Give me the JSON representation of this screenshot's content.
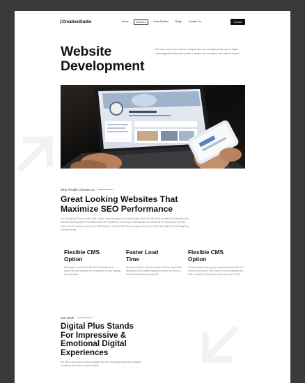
{
  "brand": {
    "name": "CreativeStudio"
  },
  "nav": {
    "links": [
      {
        "label": "Home",
        "active": false
      },
      {
        "label": "Services",
        "active": true
      },
      {
        "label": "Case Studies",
        "active": false
      },
      {
        "label": "Blogs",
        "active": false
      },
      {
        "label": "Contact Us",
        "active": false
      }
    ],
    "cta": "Contact"
  },
  "hero": {
    "title_line1": "Website",
    "title_line2": "Development",
    "description": "We help e-commerce brands navigate the ever-changing landscape of digital marketing with tactics that create a modern yet consistent web-based channel."
  },
  "why": {
    "eyebrow": "Why People Choose Us",
    "title_line1": "Great Looking Websites That",
    "title_line2": "Maximize SEO Performance",
    "description": "Our Designing Process starts with a basic understanding and crucial insight after that. We head towards the drawing board and start giving shape to our ideas which are backed by a thorough understanding of brands. At the completion of these steps, we are ready to move on to Wireframing. Once the Wireframe is approved by our client We begin the final designing of components."
  },
  "features": [
    {
      "title_line1": "Flexible CMS",
      "title_line2": "Option",
      "description": "We support a number of different CMS platforms to ensure that the websites we recommend fits your strategy and objectives."
    },
    {
      "title_line1": "Faster Load",
      "title_line2": "Time",
      "description": "We have extensive experience with building cleaned and decoupled CMS implementations to ensure we deliver a website that loads extremely fast."
    },
    {
      "title_line1": "Flexible CMS",
      "title_line2": "Option",
      "description": "It's now website that's going to generate more leads and revenue, why build it? We ensure all of our websites are built to maximize SEO performance and improve ROI."
    }
  ],
  "work": {
    "eyebrow": "Our Work",
    "title_lines": [
      "Digital Plus Stands",
      "For Impressive &",
      "Emotional Digital",
      "Experiences"
    ],
    "description": "We help e-commerce brands navigate the ever-changing landscape of digital marketing with best-in-class creative."
  },
  "colors": {
    "background": "#3a3a3a",
    "page": "#ffffff",
    "text": "#111111",
    "muted": "#888888",
    "cta": "#111111"
  }
}
